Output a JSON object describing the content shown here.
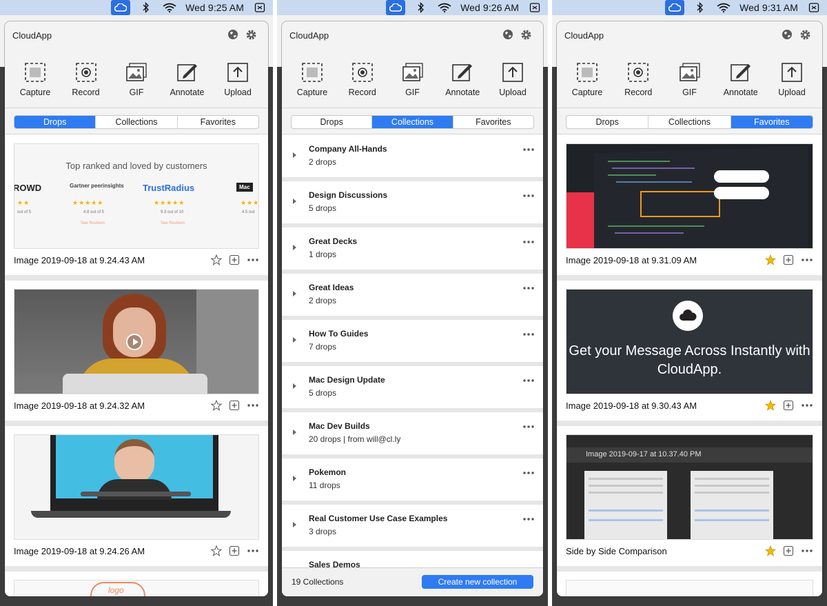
{
  "menubar": {
    "times": [
      "Wed 9:25 AM",
      "Wed 9:26 AM",
      "Wed 9:31 AM"
    ]
  },
  "app": {
    "title": "CloudApp",
    "tools": [
      "Capture",
      "Record",
      "GIF",
      "Annotate",
      "Upload"
    ],
    "tabs": [
      "Drops",
      "Collections",
      "Favorites"
    ]
  },
  "drops": {
    "items": [
      {
        "title": "Image 2019-09-18 at 9.24.43 AM",
        "favorite": false,
        "thumb": {
          "heading": "Top ranked and loved by customers",
          "brands": [
            "ROWD",
            "Gartner peerinsights",
            "TrustRadius",
            "Mac"
          ],
          "scores": [
            "out of 5",
            "4.8 out of 5",
            "9.3 out of 10",
            "4.5 out"
          ],
          "see_reviews": "See Reviews"
        }
      },
      {
        "title": "Image 2019-09-18 at 9.24.32 AM",
        "favorite": false
      },
      {
        "title": "Image 2019-09-18 at 9.24.26 AM",
        "favorite": false
      }
    ],
    "partial_thumb_text": "logo"
  },
  "collections": {
    "items": [
      {
        "name": "Company All-Hands",
        "sub": "2 drops"
      },
      {
        "name": "Design Discussions",
        "sub": "5 drops"
      },
      {
        "name": "Great Decks",
        "sub": "1 drops"
      },
      {
        "name": "Great Ideas",
        "sub": "2 drops"
      },
      {
        "name": "How To Guides",
        "sub": "7 drops"
      },
      {
        "name": "Mac Design Update",
        "sub": "5 drops"
      },
      {
        "name": "Mac Dev Builds",
        "sub": "20 drops | from will@cl.ly"
      },
      {
        "name": "Pokemon",
        "sub": "11 drops"
      },
      {
        "name": "Real Customer Use Case Examples",
        "sub": "3 drops"
      },
      {
        "name": "Sales Demos",
        "sub": ""
      }
    ],
    "count": "19 Collections",
    "create_label": "Create new collection"
  },
  "favorites": {
    "items": [
      {
        "title": "Image 2019-09-18 at 9.31.09 AM",
        "favorite": true
      },
      {
        "title": "Image 2019-09-18 at 9.30.43 AM",
        "favorite": true,
        "thumb_text": "Get your Message Across Instantly with CloudApp."
      },
      {
        "title": "Side by Side Comparison",
        "favorite": true,
        "thumb_bar_title": "Image 2019-09-17 at 10.37.40 PM"
      }
    ]
  },
  "colors": {
    "accent": "#2f7bf2",
    "menubar": "#c9daf0",
    "star_active": "#f5b800"
  }
}
